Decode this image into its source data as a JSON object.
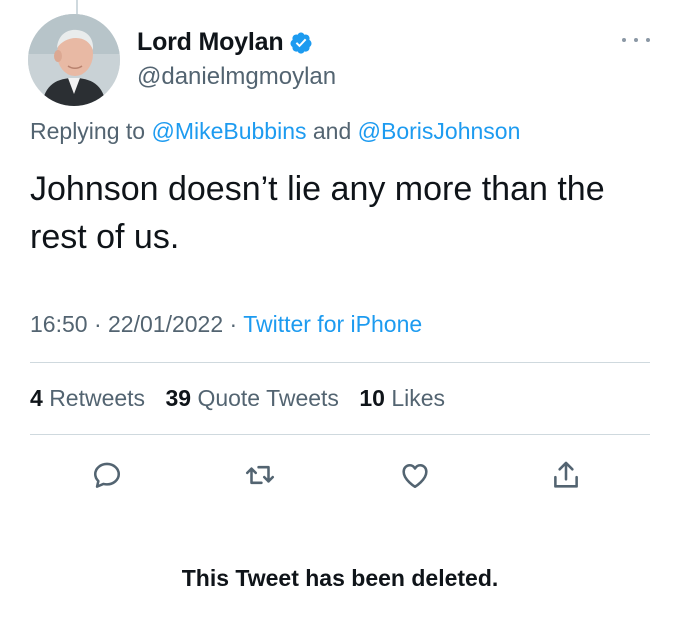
{
  "author": {
    "display_name": "Lord Moylan",
    "handle": "@danielmgmoylan",
    "verified": true
  },
  "reply": {
    "prefix": "Replying to",
    "mention_1": "@MikeBubbins",
    "conjunction": "and",
    "mention_2": "@BorisJohnson"
  },
  "tweet": {
    "text": "Johnson doesn’t lie any more than the rest of us."
  },
  "meta": {
    "time": "16:50",
    "date": "22/01/2022",
    "separator": "·",
    "source": "Twitter for iPhone"
  },
  "stats": {
    "retweets_count": "4",
    "retweets_label": "Retweets",
    "quotes_count": "39",
    "quotes_label": "Quote Tweets",
    "likes_count": "10",
    "likes_label": "Likes"
  },
  "actions": {
    "icons": [
      "reply-icon",
      "retweet-icon",
      "like-icon",
      "share-icon"
    ]
  },
  "colors": {
    "accent": "#1d9bf0",
    "secondary_text": "#536471",
    "primary_text": "#0f1419",
    "divider": "#cfd9de"
  },
  "notice": {
    "deleted": "This Tweet has been deleted."
  }
}
